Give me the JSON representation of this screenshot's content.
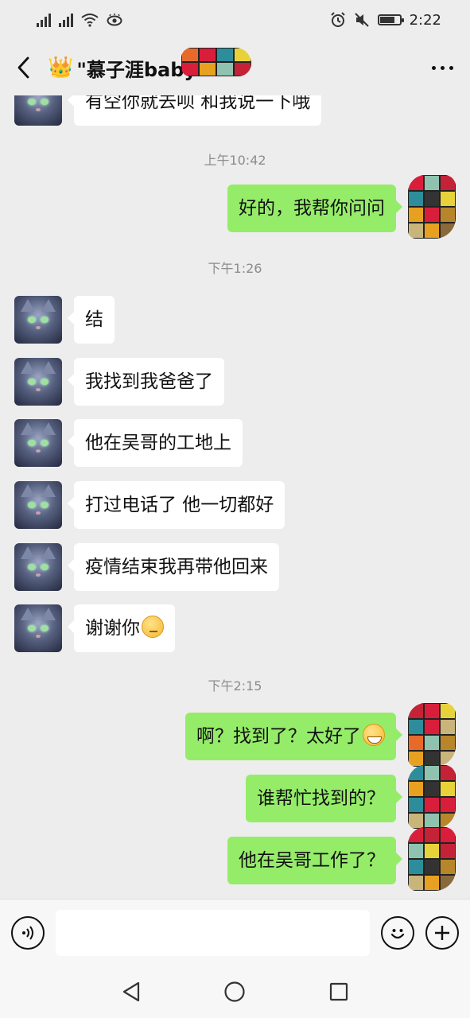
{
  "status_bar": {
    "time": "2:22",
    "icons": [
      "signal-icon",
      "signal-icon",
      "wifi-icon",
      "eye-icon",
      "alarm-icon",
      "mute-icon",
      "battery-icon"
    ]
  },
  "header": {
    "crown_emoji": "👑",
    "title": "\"慕子涯baby",
    "back_icon": "chevron-left-icon",
    "more_icon": "more-icon"
  },
  "messages": [
    {
      "side": "left",
      "text": "有空你就去呗 和我说一下哦"
    },
    {
      "side": "time",
      "text": "上午10:42"
    },
    {
      "side": "right",
      "text": "好的，我帮你问问"
    },
    {
      "side": "time",
      "text": "下午1:26"
    },
    {
      "side": "left",
      "text": "结"
    },
    {
      "side": "left",
      "text": "我找到我爸爸了"
    },
    {
      "side": "left",
      "text": "他在吴哥的工地上"
    },
    {
      "side": "left",
      "text": "打过电话了 他一切都好"
    },
    {
      "side": "left",
      "text": "疫情结束我再带他回来"
    },
    {
      "side": "left",
      "text": "谢谢你",
      "emoji": "thinking-emoji"
    },
    {
      "side": "time",
      "text": "下午2:15"
    },
    {
      "side": "right",
      "text": "啊？找到了？太好了",
      "emoji": "grin-emoji"
    },
    {
      "side": "right",
      "text": "谁帮忙找到的？"
    },
    {
      "side": "right",
      "text": "他在吴哥工作了？"
    }
  ],
  "input_bar": {
    "voice_icon": "voice-icon",
    "text_value": "",
    "emoji_icon": "smiley-icon",
    "plus_icon": "plus-icon"
  },
  "nav_bar": {
    "icons": [
      "back-triangle-icon",
      "home-circle-icon",
      "recents-square-icon"
    ]
  },
  "colors": {
    "background": "#ededed",
    "sent_bubble": "#95ec69",
    "received_bubble": "#ffffff",
    "timestamp": "#8c8c8c"
  }
}
